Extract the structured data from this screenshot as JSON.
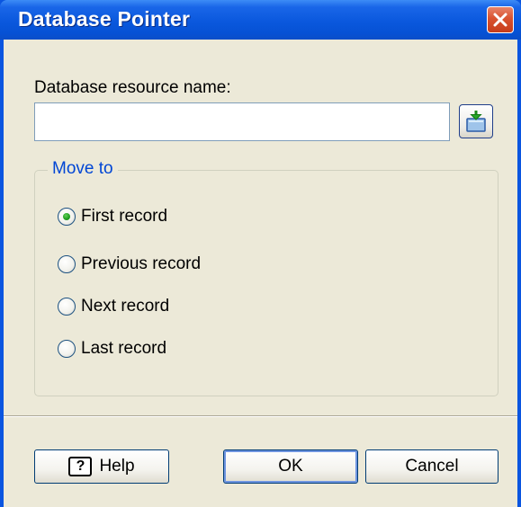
{
  "window": {
    "title": "Database Pointer",
    "colors": {
      "titlebar": "#0a58dd",
      "client": "#ece9d8",
      "close": "#d9522f",
      "group_legend": "#0046d5"
    }
  },
  "resource": {
    "label": "Database resource name:",
    "value": "",
    "browse_icon": "browse-database-icon"
  },
  "move_to": {
    "legend": "Move to",
    "options": [
      {
        "label": "First record",
        "selected": true
      },
      {
        "label": "Previous record",
        "selected": false
      },
      {
        "label": "Next record",
        "selected": false
      },
      {
        "label": "Last record",
        "selected": false
      }
    ]
  },
  "buttons": {
    "help": "Help",
    "help_icon": "question-icon",
    "ok": "OK",
    "cancel": "Cancel"
  }
}
